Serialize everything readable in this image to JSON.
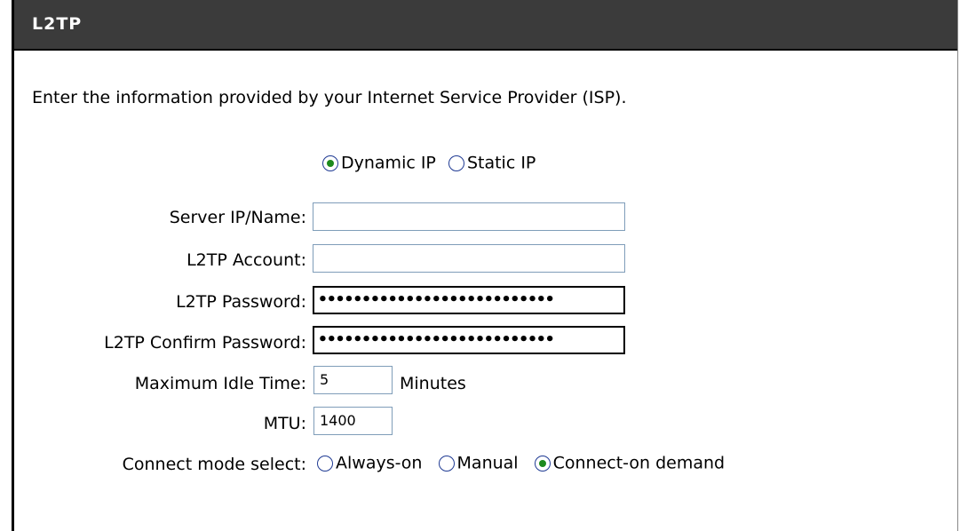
{
  "section": {
    "title": "L2TP"
  },
  "intro": "Enter the information provided by your Internet Service Provider (ISP).",
  "ip_mode": {
    "options": [
      {
        "label": "Dynamic IP",
        "selected": true
      },
      {
        "label": "Static IP",
        "selected": false
      }
    ]
  },
  "fields": {
    "server": {
      "label": "Server IP/Name:",
      "value": ""
    },
    "account": {
      "label": "L2TP Account:",
      "value": ""
    },
    "password": {
      "label": "L2TP Password:",
      "value": "•••••••••••••••••••••••••••"
    },
    "confirm": {
      "label": "L2TP Confirm Password:",
      "value": "•••••••••••••••••••••••••••"
    },
    "idle": {
      "label": "Maximum Idle Time:",
      "value": "5",
      "unit": "Minutes"
    },
    "mtu": {
      "label": "MTU:",
      "value": "1400"
    }
  },
  "connect_mode": {
    "label": "Connect mode select:",
    "options": [
      {
        "label": "Always-on",
        "selected": false
      },
      {
        "label": "Manual",
        "selected": false
      },
      {
        "label": "Connect-on demand",
        "selected": true
      }
    ]
  },
  "colors": {
    "header_bg": "#3b3b3b",
    "radio_dot": "#1d8a1d",
    "input_border": "#7f9db9"
  }
}
